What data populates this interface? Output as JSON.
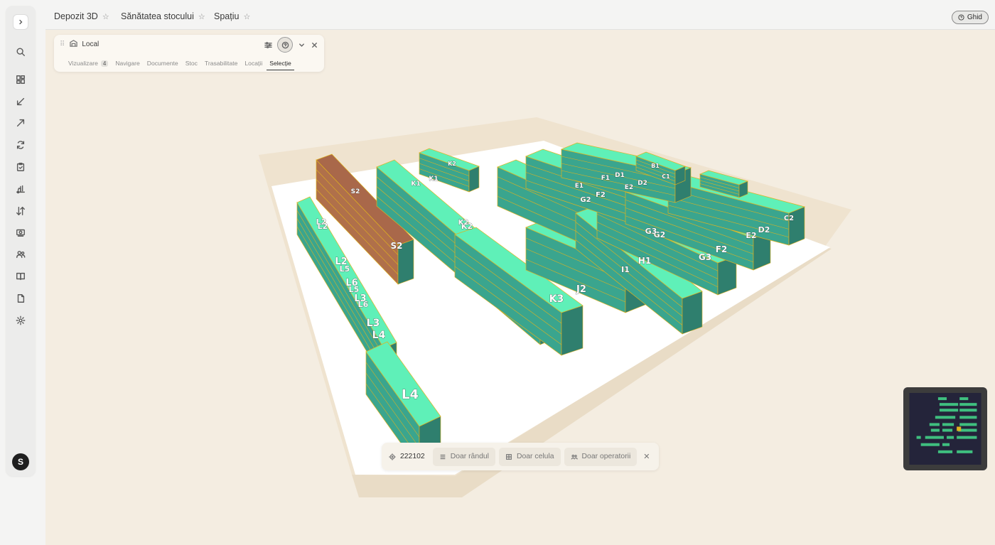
{
  "tabs": [
    {
      "label": "Depozit 3D",
      "active": true
    },
    {
      "label": "Sănătatea stocului",
      "active": false
    },
    {
      "label": "Spațiu",
      "active": false
    }
  ],
  "ghid_label": "Ghid",
  "panel": {
    "title": "Local",
    "tabs": [
      {
        "label": "Vizualizare",
        "badge": "4"
      },
      {
        "label": "Navigare"
      },
      {
        "label": "Documente"
      },
      {
        "label": "Stoc"
      },
      {
        "label": "Trasabilitate"
      },
      {
        "label": "Locații"
      },
      {
        "label": "Selecție",
        "active": true
      }
    ]
  },
  "sidebar": {
    "icons": [
      "search-icon",
      "dashboard-icon",
      "inbound-arrow-icon",
      "outbound-arrow-icon",
      "sync-icon",
      "clipboard-icon",
      "forklift-icon",
      "transfer-icon",
      "cash-icon",
      "users-icon",
      "book-icon",
      "document-icon",
      "settings-icon"
    ],
    "user_initial": "S"
  },
  "bottom": {
    "location": "222102",
    "buttons": [
      {
        "label": "Doar rândul",
        "icon": "rows-icon"
      },
      {
        "label": "Doar celula",
        "icon": "grid-icon"
      },
      {
        "label": "Doar operatorii",
        "icon": "people-icon"
      }
    ]
  },
  "rack_labels": [
    "S2",
    "L2",
    "L2",
    "L5",
    "L6",
    "L5",
    "L3",
    "L6",
    "L3",
    "L4",
    "L4",
    "K3",
    "J2",
    "I1",
    "H1",
    "G3",
    "G2",
    "F2",
    "E2",
    "D2",
    "C2",
    "K2",
    "K2",
    "G2",
    "F2",
    "E2",
    "D2",
    "D1",
    "B1",
    "C1"
  ],
  "colors": {
    "accent": "#1f1f1f",
    "rack_top": "#5ff0b8",
    "rack_side": "#3aa58e",
    "rack_pallet": "#b0704a",
    "floor": "#ffffff",
    "viewport_bg": "#f4ede1"
  }
}
